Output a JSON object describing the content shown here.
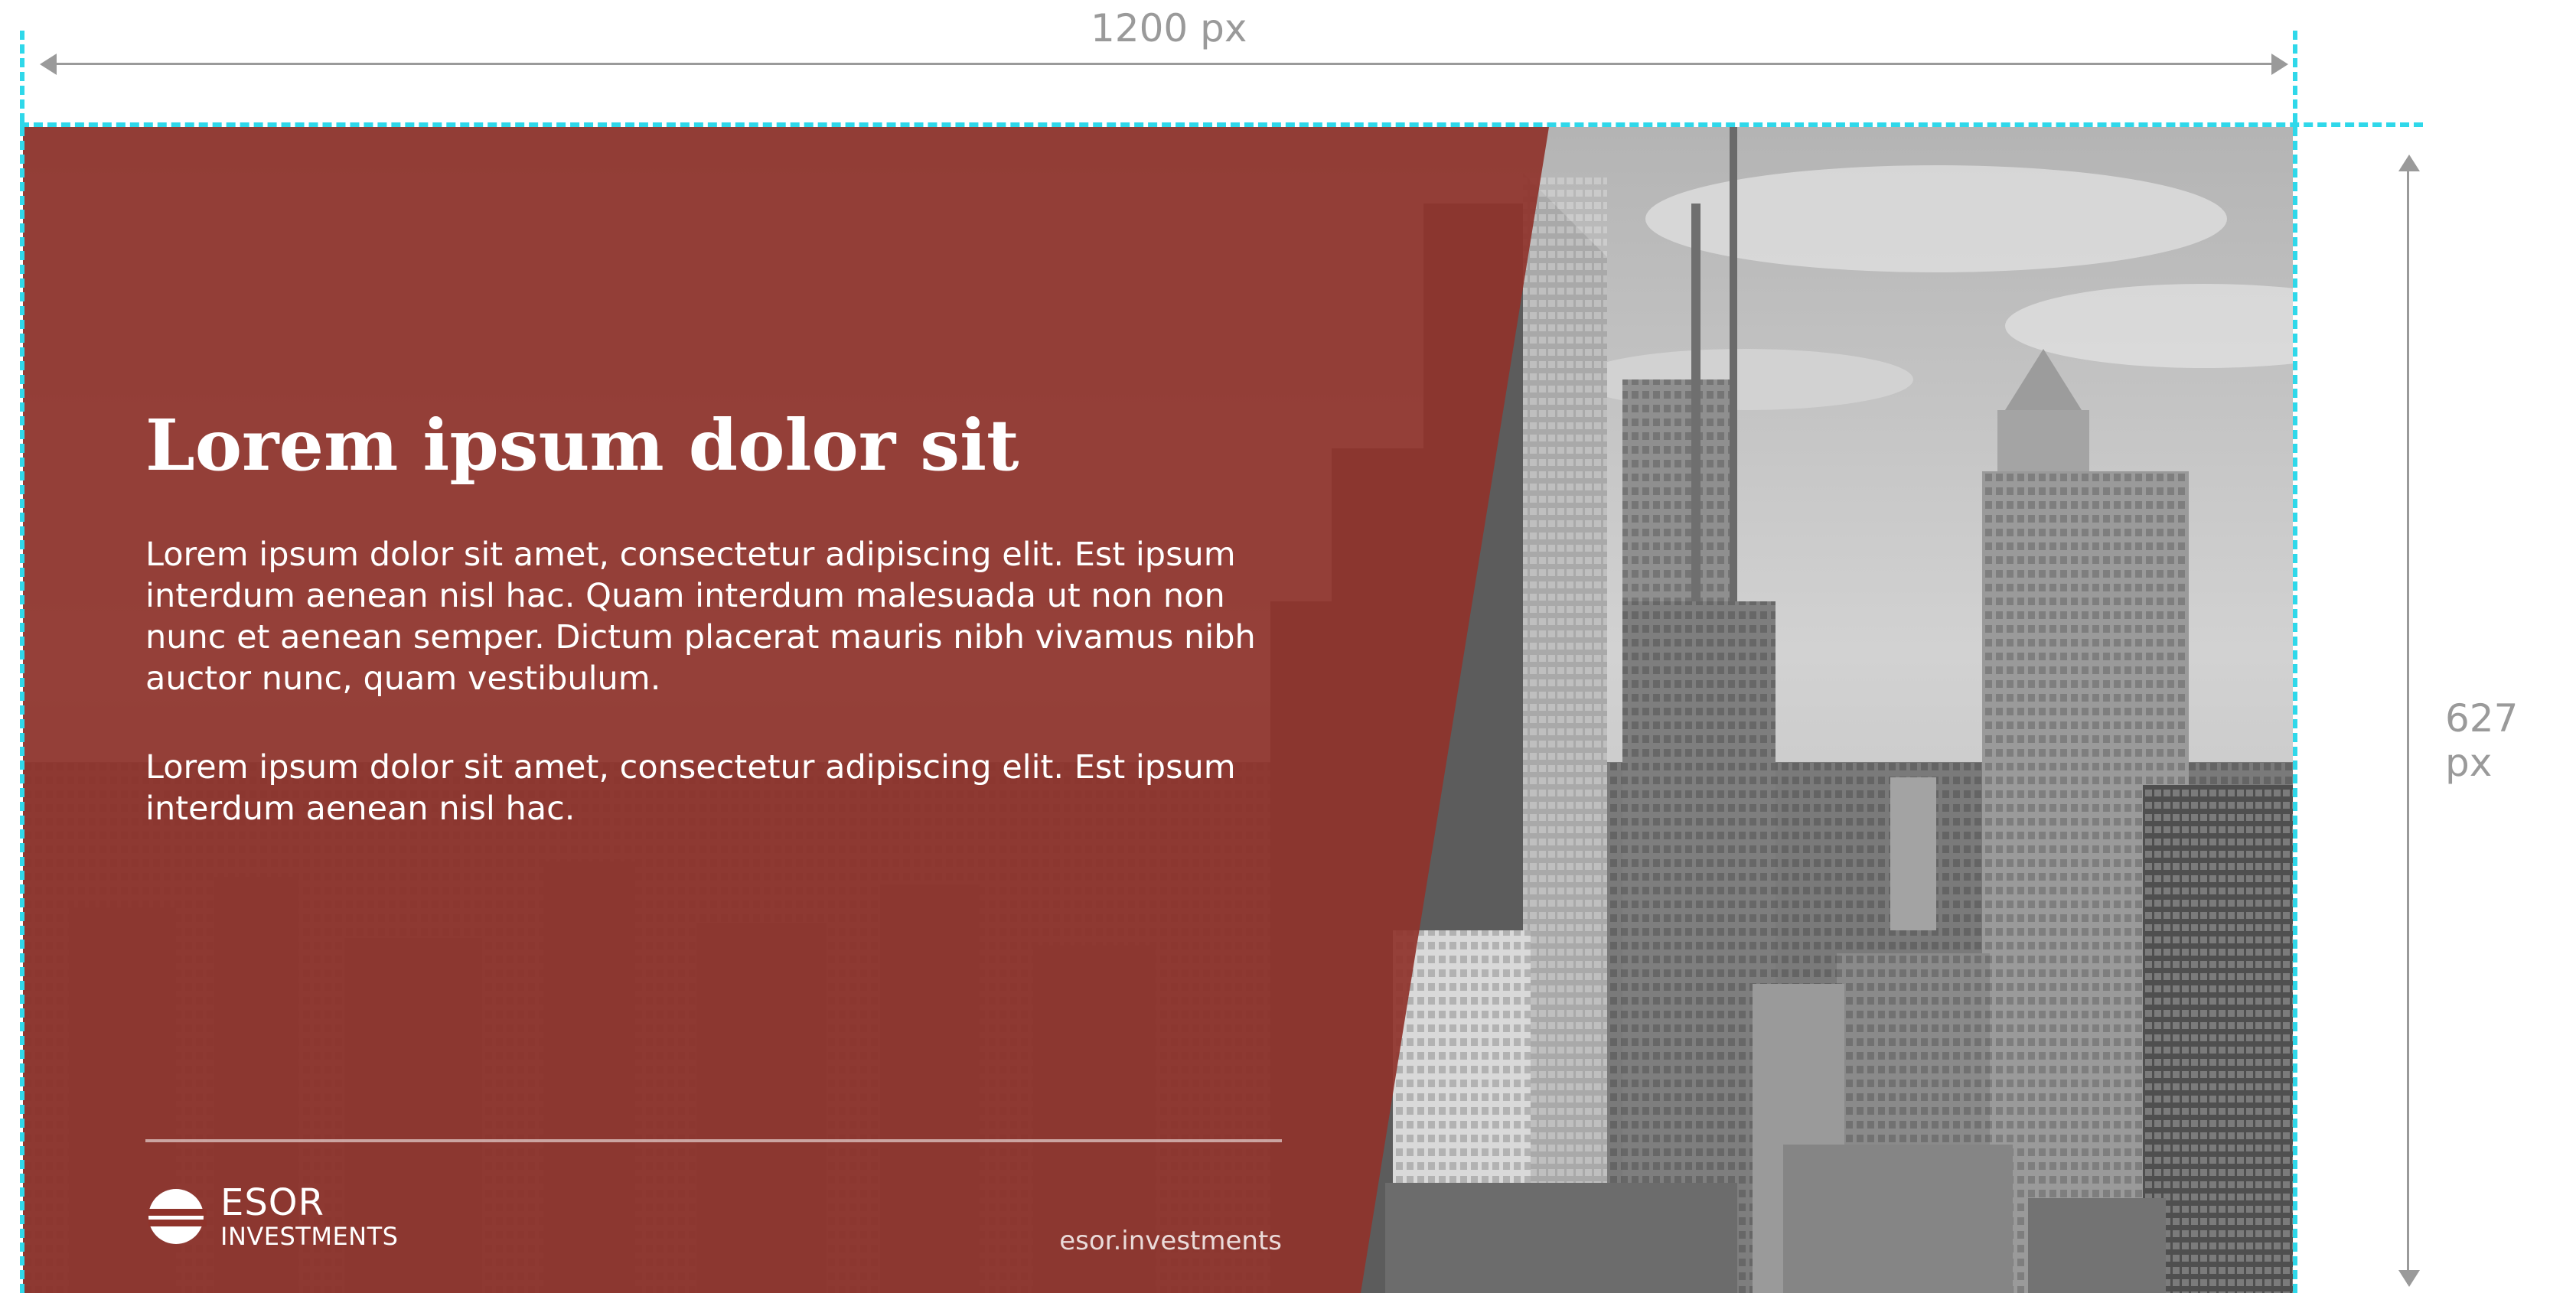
{
  "annotations": {
    "width_label": "1200 px",
    "height_label": "627 px",
    "guide_color": "#2fd8ea",
    "dimension_color": "#9a9a9a"
  },
  "banner": {
    "title": "Lorem ipsum dolor sit",
    "paragraph1": "Lorem ipsum dolor sit amet, consectetur adipiscing elit. Est ipsum interdum aenean nisl hac. Quam interdum malesuada ut non non nunc et aenean semper. Dictum placerat mauris nibh vivamus nibh auctor nunc, quam vestibulum.",
    "paragraph2": "Lorem ipsum dolor sit amet, consectetur adipiscing elit. Est ipsum interdum aenean nisl hac.",
    "logo_line1": "ESOR",
    "logo_line2": "INVESTMENTS",
    "url": "esor.investments",
    "overlay_color": "#8f332b",
    "photo_icon": "city-skyline-photo",
    "logo_icon": "esor-logo-icon"
  }
}
